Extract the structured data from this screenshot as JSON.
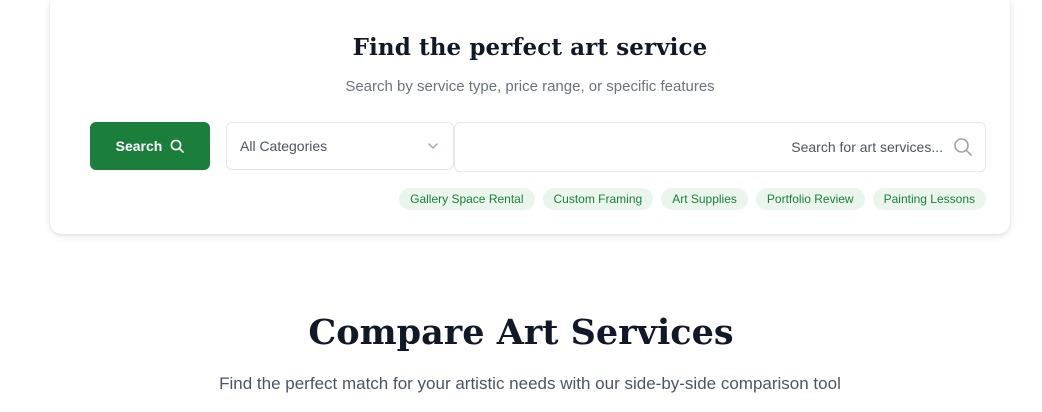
{
  "search_card": {
    "title": "Find the perfect art service",
    "subtitle": "Search by service type, price range, or specific features",
    "search_button_label": "Search",
    "category_select": {
      "selected": "All Categories"
    },
    "search_input": {
      "placeholder": "...Search for art services",
      "value": ""
    },
    "tags": [
      {
        "label": "Gallery Space Rental"
      },
      {
        "label": "Custom Framing"
      },
      {
        "label": "Art Supplies"
      },
      {
        "label": "Portfolio Review"
      },
      {
        "label": "Painting Lessons"
      }
    ]
  },
  "compare_section": {
    "title": "Compare Art Services",
    "subtitle": "Find the perfect match for your artistic needs with our side-by-side comparison tool"
  },
  "theme": {
    "accent": "#1b7f3b",
    "tag_background": "#eaf6ec",
    "muted_text": "#6b7280"
  },
  "icons": {
    "search_button_icon": "search-icon",
    "select_icon": "chevron-down-icon",
    "input_icon": "search-icon"
  }
}
